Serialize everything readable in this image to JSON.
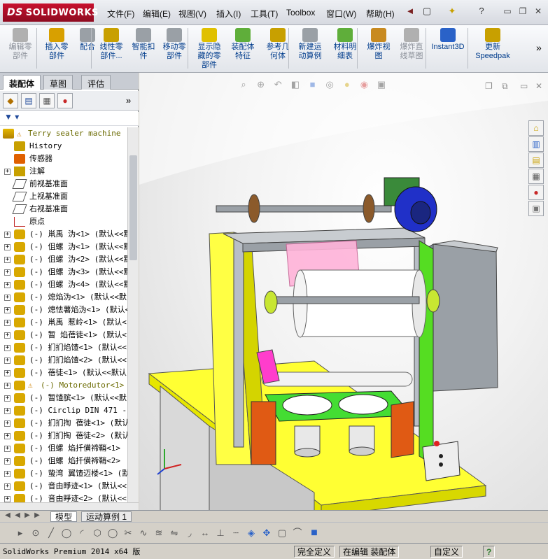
{
  "app": {
    "logo_text": "SOLIDWORKS",
    "logo_prefix": "DS"
  },
  "menu": [
    "文件(F)",
    "编辑(E)",
    "视图(V)",
    "插入(I)",
    "工具(T)",
    "Toolbox",
    "窗口(W)",
    "帮助(H)"
  ],
  "quick_access": {
    "new": "□",
    "open": "↗",
    "search": "?"
  },
  "ribbon": [
    {
      "label": "编辑零\n部件",
      "icon": "edit-component-icon",
      "disabled": true
    },
    {
      "label": "插入零\n部件",
      "icon": "insert-component-icon",
      "disabled": false
    },
    {
      "label": "配合",
      "icon": "mate-icon",
      "disabled": false
    },
    {
      "label": "线性零\n部件...",
      "icon": "linear-pattern-icon",
      "disabled": false
    },
    {
      "label": "智能扣\n件",
      "icon": "smart-fastener-icon",
      "disabled": false
    },
    {
      "label": "移动零\n部件",
      "icon": "move-component-icon",
      "disabled": false
    },
    {
      "label": "显示隐\n藏的零\n部件",
      "icon": "show-hidden-icon",
      "disabled": false
    },
    {
      "label": "装配体\n特征",
      "icon": "assembly-feature-icon",
      "disabled": false
    },
    {
      "label": "参考几\n何体",
      "icon": "reference-geometry-icon",
      "disabled": false
    },
    {
      "label": "新建运\n动算例",
      "icon": "motion-study-icon",
      "disabled": false
    },
    {
      "label": "材料明\n细表",
      "icon": "bom-icon",
      "disabled": false
    },
    {
      "label": "爆炸视\n图",
      "icon": "exploded-view-icon",
      "disabled": false
    },
    {
      "label": "爆炸直\n线草图",
      "icon": "explode-line-icon",
      "disabled": true
    },
    {
      "label": "Instant3D",
      "icon": "instant3d-icon",
      "disabled": false
    },
    {
      "label": "更新\nSpeedpak",
      "icon": "speedpak-icon",
      "disabled": false
    }
  ],
  "left_tabs": [
    "装配体",
    "草图",
    "评估"
  ],
  "tree": {
    "root": "Terry sealer machine",
    "items": [
      {
        "label": "History",
        "icon": "history-icon",
        "exp": false
      },
      {
        "label": "传感器",
        "icon": "sensor-icon",
        "exp": false
      },
      {
        "label": "注解",
        "icon": "annotation-icon",
        "exp": true
      },
      {
        "label": "前视基准面",
        "icon": "plane-icon",
        "exp": false
      },
      {
        "label": "上视基准面",
        "icon": "plane-icon",
        "exp": false
      },
      {
        "label": "右视基准面",
        "icon": "plane-icon",
        "exp": false
      },
      {
        "label": "原点",
        "icon": "origin-icon",
        "exp": false
      },
      {
        "label": "(-) 鼡禹 沩<1> (默认<<默",
        "icon": "part-icon",
        "exp": true
      },
      {
        "label": "(-) 伹螺 沩<1> (默认<<默",
        "icon": "part-icon",
        "exp": true
      },
      {
        "label": "(-) 伹螺 沩<2> (默认<<默",
        "icon": "part-icon",
        "exp": true
      },
      {
        "label": "(-) 伹螺 沩<3> (默认<<默",
        "icon": "part-icon",
        "exp": true
      },
      {
        "label": "(-) 伹螺 沩<4> (默认<<默",
        "icon": "part-icon",
        "exp": true
      },
      {
        "label": "(-) 熄焰沩<1> (默认<<默",
        "icon": "part-icon",
        "exp": true
      },
      {
        "label": "(-) 熄怯薯焰沩<1> (默认<",
        "icon": "part-icon",
        "exp": true
      },
      {
        "label": "(-) 鼡禹 惹岭<1> (默认<",
        "icon": "part-icon",
        "exp": true
      },
      {
        "label": "(-) 暂 焰蓓徒<1> (默认<",
        "icon": "part-icon",
        "exp": true
      },
      {
        "label": "(-) 扪扪焰馇<1> (默认<<",
        "icon": "part-icon",
        "exp": true
      },
      {
        "label": "(-) 扪扪焰馇<2> (默认<<",
        "icon": "part-icon",
        "exp": true
      },
      {
        "label": "(-) 蓓徒<1> (默认<<默认",
        "icon": "part-icon",
        "exp": true
      },
      {
        "label": "(-) Motoredutor<1> (",
        "icon": "part-warn-icon",
        "exp": true,
        "warn": true
      },
      {
        "label": "(-) 暂馇膑<1> (默认<<默",
        "icon": "part-icon",
        "exp": true
      },
      {
        "label": "(-) Circlip DIN 471 - 2",
        "icon": "part-icon",
        "exp": true
      },
      {
        "label": "(-) 扪扪掏 蓓徒<1> (默认",
        "icon": "part-icon",
        "exp": true
      },
      {
        "label": "(-) 扪扪掏 蓓徒<2> (默认",
        "icon": "part-icon",
        "exp": true
      },
      {
        "label": "(-) 伹螺 焰扦僙禘鞘<1>",
        "icon": "part-icon",
        "exp": true
      },
      {
        "label": "(-) 伹螺 焰扦僙禘鞘<2>",
        "icon": "part-icon",
        "exp": true
      },
      {
        "label": "(-) 蛰湾 翼馇迈楼<1> (默",
        "icon": "part-icon",
        "exp": true
      },
      {
        "label": "(-) 音由睜迹<1> (默认<<",
        "icon": "part-icon",
        "exp": true
      },
      {
        "label": "(-) 音由睜迹<2> (默认<<",
        "icon": "part-icon",
        "exp": true
      }
    ]
  },
  "bottom_tabs": [
    "模型",
    "运动算例 1"
  ],
  "status": {
    "app_name": "SolidWorks Premium 2014 x64 版",
    "fully_defined": "完全定义",
    "editing": "在编辑 装配体",
    "custom": "自定义",
    "help": "?"
  },
  "colors": {
    "accent": "#c8102e",
    "ribbon_text": "#003c8c"
  }
}
